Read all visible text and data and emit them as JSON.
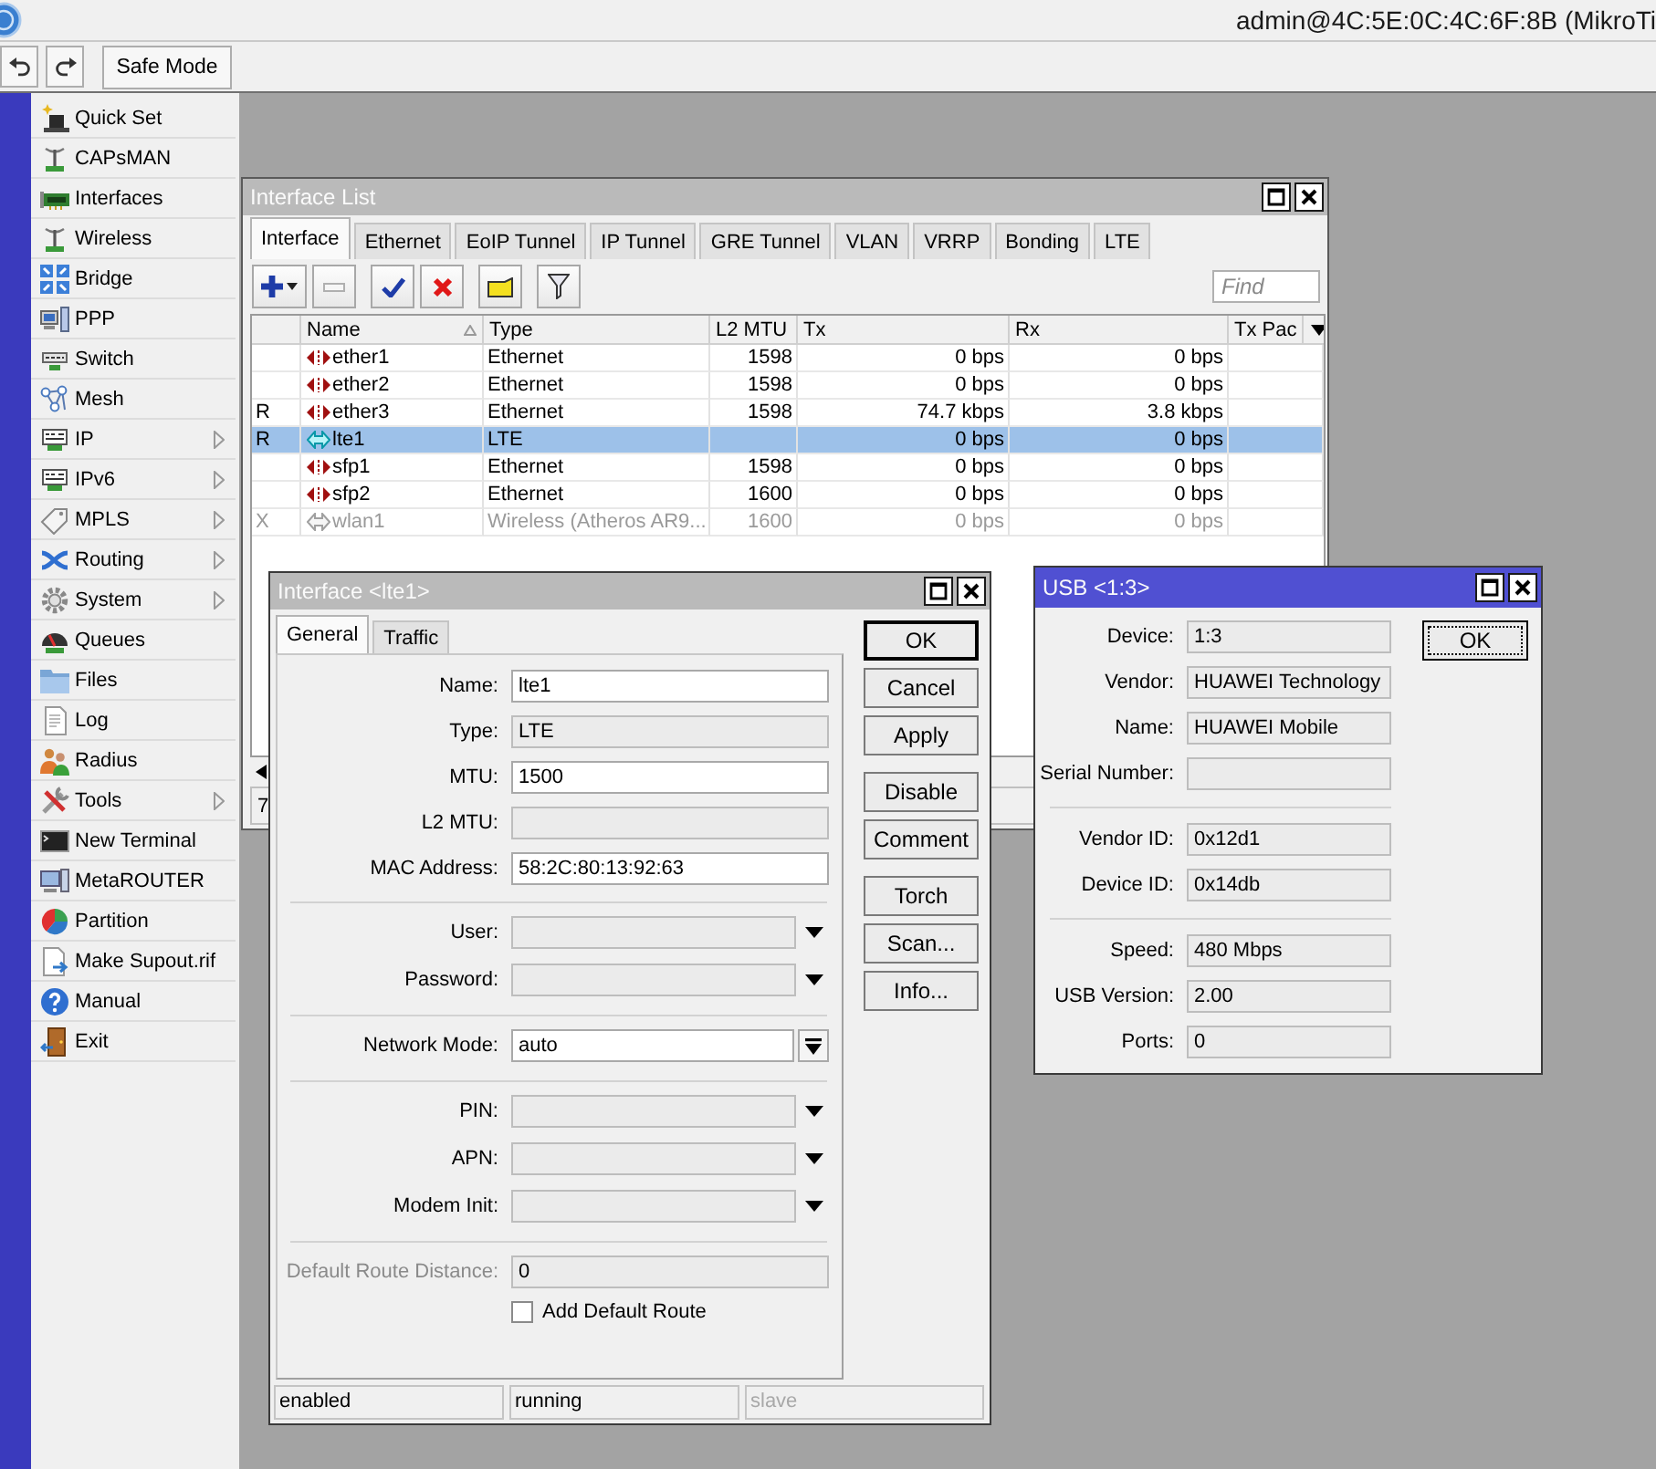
{
  "window": {
    "title": "admin@4C:5E:0C:4C:6F:8B (MikroTi"
  },
  "toolbar": {
    "safe_mode": "Safe Mode"
  },
  "sidebar": {
    "items": [
      {
        "label": "Quick Set",
        "submenu": false
      },
      {
        "label": "CAPsMAN",
        "submenu": false
      },
      {
        "label": "Interfaces",
        "submenu": false
      },
      {
        "label": "Wireless",
        "submenu": false
      },
      {
        "label": "Bridge",
        "submenu": false
      },
      {
        "label": "PPP",
        "submenu": false
      },
      {
        "label": "Switch",
        "submenu": false
      },
      {
        "label": "Mesh",
        "submenu": false
      },
      {
        "label": "IP",
        "submenu": true
      },
      {
        "label": "IPv6",
        "submenu": true
      },
      {
        "label": "MPLS",
        "submenu": true
      },
      {
        "label": "Routing",
        "submenu": true
      },
      {
        "label": "System",
        "submenu": true
      },
      {
        "label": "Queues",
        "submenu": false
      },
      {
        "label": "Files",
        "submenu": false
      },
      {
        "label": "Log",
        "submenu": false
      },
      {
        "label": "Radius",
        "submenu": false
      },
      {
        "label": "Tools",
        "submenu": true
      },
      {
        "label": "New Terminal",
        "submenu": false
      },
      {
        "label": "MetaROUTER",
        "submenu": false
      },
      {
        "label": "Partition",
        "submenu": false
      },
      {
        "label": "Make Supout.rif",
        "submenu": false
      },
      {
        "label": "Manual",
        "submenu": false
      },
      {
        "label": "Exit",
        "submenu": false
      }
    ]
  },
  "interface_list": {
    "title": "Interface List",
    "active": false,
    "tabs": [
      {
        "label": "Interface",
        "selected": true
      },
      {
        "label": "Ethernet",
        "selected": false
      },
      {
        "label": "EoIP Tunnel",
        "selected": false
      },
      {
        "label": "IP Tunnel",
        "selected": false
      },
      {
        "label": "GRE Tunnel",
        "selected": false
      },
      {
        "label": "VLAN",
        "selected": false
      },
      {
        "label": "VRRP",
        "selected": false
      },
      {
        "label": "Bonding",
        "selected": false
      },
      {
        "label": "LTE",
        "selected": false
      }
    ],
    "find": {
      "placeholder": "Find"
    },
    "table": {
      "columns": [
        {
          "label": "Name",
          "sorted": true
        },
        {
          "label": "Type",
          "sorted": false
        },
        {
          "label": "L2 MTU",
          "sorted": false
        },
        {
          "label": "Tx",
          "sorted": false
        },
        {
          "label": "Rx",
          "sorted": false
        },
        {
          "label": "Tx Pac",
          "sorted": false
        }
      ],
      "rows": [
        {
          "name": "ether1",
          "type": "Ethernet",
          "l2_mtu": "1598",
          "tx": "0 bps",
          "rx": "0 bps",
          "kind": "wired",
          "selected": false,
          "disabled": false
        },
        {
          "name": "ether2",
          "type": "Ethernet",
          "l2_mtu": "1598",
          "tx": "0 bps",
          "rx": "0 bps",
          "kind": "wired",
          "selected": false,
          "disabled": false
        },
        {
          "flag": "R",
          "name": "ether3",
          "type": "Ethernet",
          "l2_mtu": "1598",
          "tx": "74.7 kbps",
          "rx": "3.8 kbps",
          "kind": "wired",
          "selected": false,
          "disabled": false
        },
        {
          "flag": "R",
          "name": "lte1",
          "type": "LTE",
          "tx": "0 bps",
          "rx": "0 bps",
          "kind": "radio",
          "selected": true,
          "disabled": false
        },
        {
          "name": "sfp1",
          "type": "Ethernet",
          "l2_mtu": "1598",
          "tx": "0 bps",
          "rx": "0 bps",
          "kind": "wired",
          "selected": false,
          "disabled": false
        },
        {
          "name": "sfp2",
          "type": "Ethernet",
          "l2_mtu": "1600",
          "tx": "0 bps",
          "rx": "0 bps",
          "kind": "wired",
          "selected": false,
          "disabled": false
        },
        {
          "flag": "X",
          "name": "wlan1",
          "type": "Wireless (Atheros AR9...",
          "l2_mtu": "1600",
          "tx": "0 bps",
          "rx": "0 bps",
          "kind": "radio",
          "selected": false,
          "disabled": true
        }
      ]
    },
    "status": "7"
  },
  "interface_window": {
    "title": "Interface <lte1>",
    "active": false,
    "tabs": [
      {
        "label": "General",
        "selected": true
      },
      {
        "label": "Traffic",
        "selected": false
      }
    ],
    "sections": [
      {
        "fields": [
          {
            "label": "Name:",
            "value": "lte1",
            "kind": "text",
            "editable": true,
            "disabled": false
          },
          {
            "label": "Type:",
            "value": "LTE",
            "kind": "text",
            "editable": false,
            "disabled": false
          },
          {
            "label": "MTU:",
            "value": "1500",
            "kind": "text",
            "editable": true,
            "disabled": false
          },
          {
            "label": "L2 MTU:",
            "kind": "text",
            "editable": false,
            "disabled": false
          },
          {
            "label": "MAC Address:",
            "value": "58:2C:80:13:92:63",
            "kind": "text",
            "editable": true,
            "disabled": false
          }
        ]
      },
      {
        "fields": [
          {
            "label": "User:",
            "kind": "combo",
            "editable": false,
            "disabled": false
          },
          {
            "label": "Password:",
            "kind": "combo",
            "editable": false,
            "disabled": false
          }
        ]
      },
      {
        "fields": [
          {
            "label": "Network Mode:",
            "value": "auto",
            "kind": "select",
            "editable": true,
            "disabled": false
          }
        ]
      },
      {
        "fields": [
          {
            "label": "PIN:",
            "kind": "combo",
            "editable": false,
            "disabled": false
          },
          {
            "label": "APN:",
            "kind": "combo",
            "editable": false,
            "disabled": false
          },
          {
            "label": "Modem Init:",
            "kind": "combo",
            "editable": false,
            "disabled": false
          }
        ]
      },
      {
        "fields": [
          {
            "label": "Default Route Distance:",
            "value": "0",
            "kind": "text",
            "editable": false,
            "disabled": true
          }
        ]
      }
    ],
    "checkbox": {
      "label": "Add Default Route",
      "checked": false
    },
    "button_groups": [
      [
        {
          "label": "OK",
          "default": true
        },
        {
          "label": "Cancel",
          "default": false
        },
        {
          "label": "Apply",
          "default": false
        }
      ],
      [
        {
          "label": "Disable",
          "default": false
        },
        {
          "label": "Comment",
          "default": false
        }
      ],
      [
        {
          "label": "Torch",
          "default": false
        },
        {
          "label": "Scan...",
          "default": false
        },
        {
          "label": "Info...",
          "default": false
        }
      ]
    ],
    "status_bar": [
      {
        "text": "enabled",
        "disabled": false
      },
      {
        "text": "running",
        "disabled": false
      },
      {
        "text": "slave",
        "disabled": true
      }
    ]
  },
  "usb_window": {
    "title": "USB <1:3>",
    "active": true,
    "sections": [
      {
        "fields": [
          {
            "label": "Device:",
            "value": "1:3"
          },
          {
            "label": "Vendor:",
            "value": "HUAWEI Technology"
          },
          {
            "label": "Name:",
            "value": "HUAWEI Mobile"
          },
          {
            "label": "Serial Number:"
          }
        ]
      },
      {
        "fields": [
          {
            "label": "Vendor ID:",
            "value": "0x12d1"
          },
          {
            "label": "Device ID:",
            "value": "0x14db"
          }
        ]
      },
      {
        "fields": [
          {
            "label": "Speed:",
            "value": "480 Mbps"
          },
          {
            "label": "USB Version:",
            "value": "2.00"
          },
          {
            "label": "Ports:",
            "value": "0"
          }
        ]
      }
    ],
    "button": {
      "label": "OK",
      "focused": true
    }
  }
}
